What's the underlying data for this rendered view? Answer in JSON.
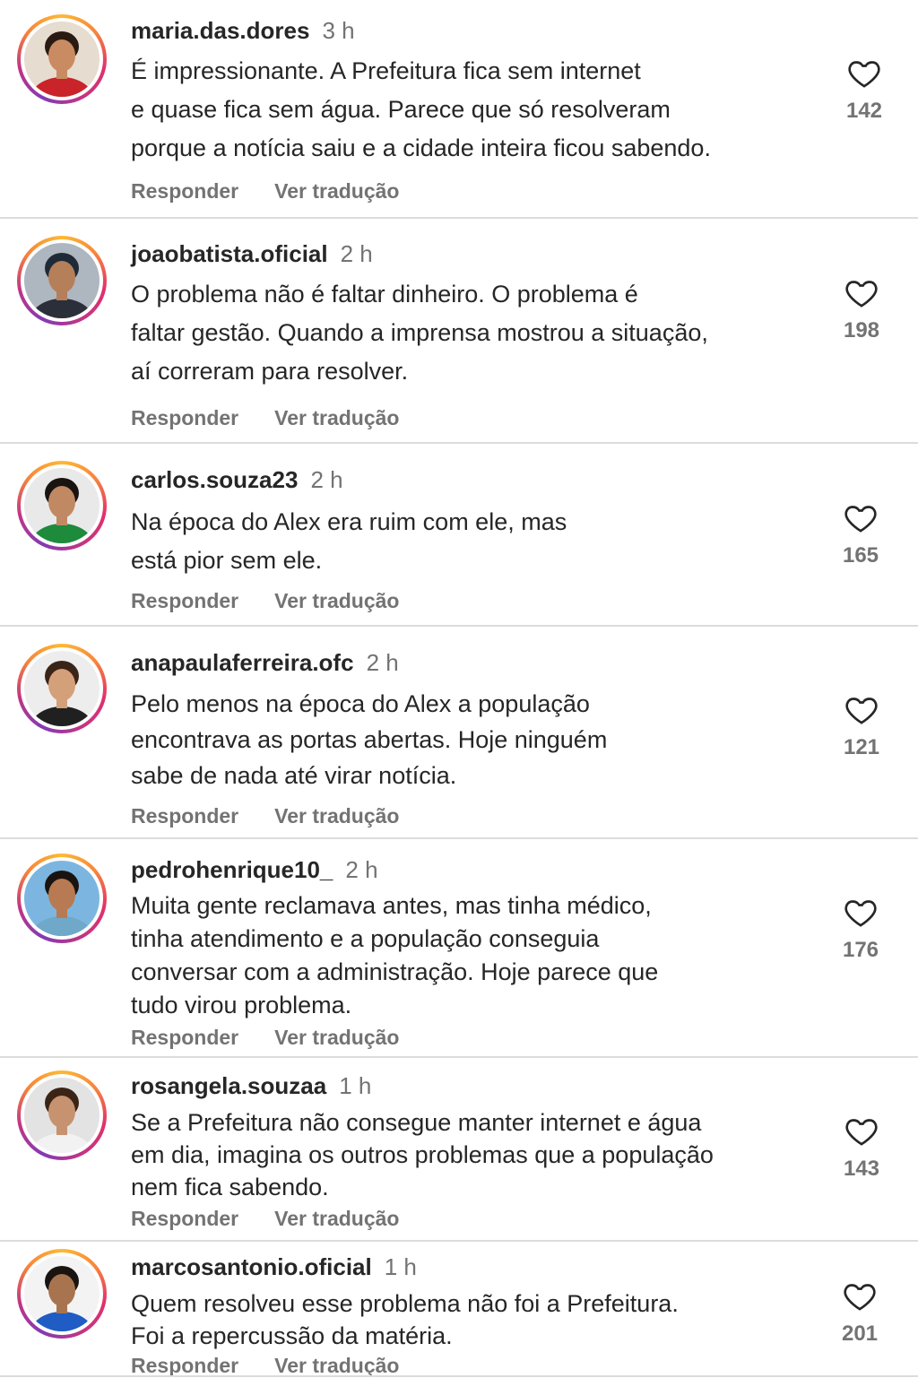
{
  "comments": [
    {
      "username": "maria.das.dores",
      "time": "3 h",
      "lines": [
        "É impressionante. A Prefeitura fica sem internet",
        "e quase fica sem água. Parece que só resolveram",
        "porque a notícia saiu e a cidade inteira ficou sabendo."
      ],
      "reply": "Responder",
      "translate": "Ver tradução",
      "likes": "142",
      "avatar": {
        "skin": "#c98b62",
        "hair": "#2a1a12",
        "shirt": "#c8242a",
        "bg": "#e6dccf"
      }
    },
    {
      "username": "joaobatista.oficial",
      "time": "2 h",
      "lines": [
        "O problema não é faltar dinheiro. O problema é",
        "faltar gestão. Quando a imprensa mostrou a situação,",
        "aí correram para resolver."
      ],
      "reply": "Responder",
      "translate": "Ver tradução",
      "likes": "198",
      "avatar": {
        "skin": "#b57f5a",
        "hair": "#1f2a38",
        "shirt": "#2b2f3a",
        "bg": "#aeb6c0"
      }
    },
    {
      "username": "carlos.souza23",
      "time": "2 h",
      "lines": [
        "Na época do Alex era ruim com ele, mas",
        "está pior sem ele."
      ],
      "reply": "Responder",
      "translate": "Ver tradução",
      "likes": "165",
      "avatar": {
        "skin": "#c08963",
        "hair": "#1a1410",
        "shirt": "#1e8a3c",
        "bg": "#e9e9e9"
      }
    },
    {
      "username": "anapaulaferreira.ofc",
      "time": "2 h",
      "lines": [
        "Pelo menos na época do Alex a população",
        "encontrava as portas abertas. Hoje ninguém",
        "sabe de nada até virar notícia."
      ],
      "reply": "Responder",
      "translate": "Ver tradução",
      "likes": "121",
      "avatar": {
        "skin": "#d4a07a",
        "hair": "#3a2418",
        "shirt": "#202020",
        "bg": "#ededed"
      }
    },
    {
      "username": "pedrohenrique10_",
      "time": "2 h",
      "lines": [
        "Muita gente reclamava antes, mas tinha médico,",
        "tinha atendimento e a população conseguia",
        "conversar com a administração. Hoje parece que",
        "tudo virou problema."
      ],
      "reply": "Responder",
      "translate": "Ver tradução",
      "likes": "176",
      "avatar": {
        "skin": "#b77a52",
        "hair": "#1a1410",
        "shirt": "#6fa8c9",
        "bg": "#7cb6e0"
      }
    },
    {
      "username": "rosangela.souzaa",
      "time": "1 h",
      "lines": [
        "Se a Prefeitura não consegue manter internet e água",
        "em dia, imagina os outros problemas que a população",
        "nem fica sabendo."
      ],
      "reply": "Responder",
      "translate": "Ver tradução",
      "likes": "143",
      "avatar": {
        "skin": "#c79270",
        "hair": "#3b2416",
        "shirt": "#f2f2f2",
        "bg": "#e3e3e3"
      }
    },
    {
      "username": "marcosantonio.oficial",
      "time": "1 h",
      "lines": [
        "Quem resolveu esse problema não foi a Prefeitura.",
        "Foi a repercussão da matéria."
      ],
      "reply": "Responder",
      "translate": "Ver tradução",
      "likes": "201",
      "avatar": {
        "skin": "#a8744f",
        "hair": "#1a1410",
        "shirt": "#1f5cc4",
        "bg": "#f3f3f3"
      }
    }
  ]
}
